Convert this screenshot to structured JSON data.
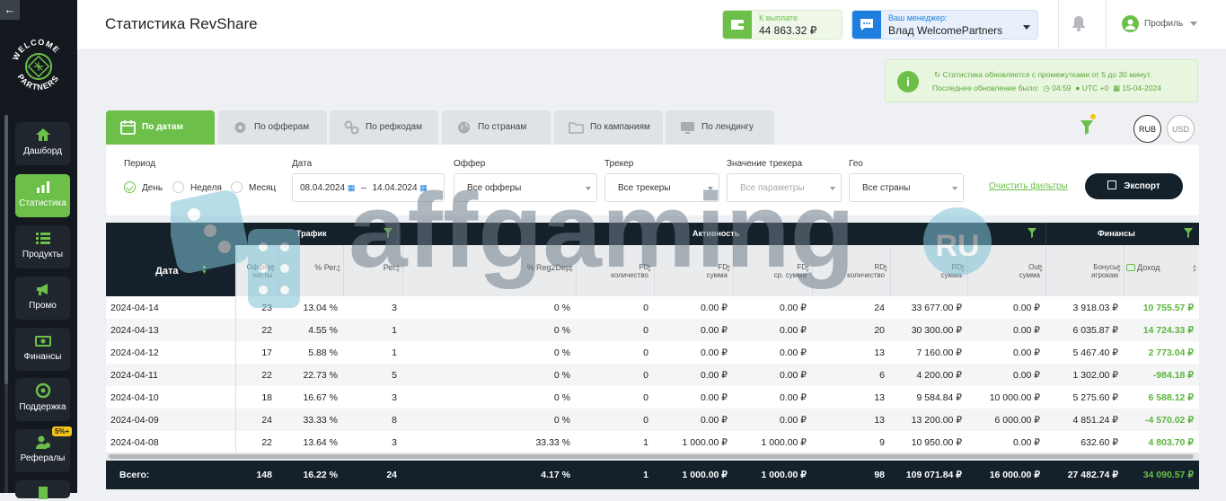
{
  "sidebar": {
    "logo_text": "WELCOME PARTNERS",
    "items": [
      {
        "label": "Дашборд",
        "icon": "home-icon",
        "active": false
      },
      {
        "label": "Статистика",
        "icon": "chart-icon",
        "active": true
      },
      {
        "label": "Продукты",
        "icon": "list-icon",
        "active": false
      },
      {
        "label": "Промо",
        "icon": "megaphone-icon",
        "active": false
      },
      {
        "label": "Финансы",
        "icon": "money-icon",
        "active": false
      },
      {
        "label": "Поддержка",
        "icon": "lifebuoy-icon",
        "active": false
      },
      {
        "label": "Рефералы",
        "icon": "referral-icon",
        "active": false,
        "badge": "5%+"
      }
    ]
  },
  "header": {
    "title": "Статистика RevShare",
    "payout": {
      "label": "К выплате",
      "value": "44 863.32 ₽"
    },
    "manager": {
      "label": "Ваш менеджер:",
      "name": "Влад WelcomePartners"
    },
    "profile_label": "Профиль"
  },
  "notice": {
    "line1": "Статистика обновляется с промежутками от 5 до 30 минут.",
    "prefix": "Последнее обновление было:",
    "time": "04:59",
    "tz": "UTC +0",
    "date": "15-04-2024"
  },
  "tabs": [
    {
      "label": "По датам",
      "icon": "calendar-icon",
      "active": true
    },
    {
      "label": "По офферам",
      "icon": "gear-icon",
      "active": false
    },
    {
      "label": "По рефкодам",
      "icon": "link-icon",
      "active": false
    },
    {
      "label": "По странам",
      "icon": "globe-icon",
      "active": false
    },
    {
      "label": "По кампаниям",
      "icon": "folder-icon",
      "active": false
    },
    {
      "label": "По лендингу",
      "icon": "monitor-icon",
      "active": false
    }
  ],
  "currency": {
    "rub": "RUB",
    "usd": "USD",
    "selected": "RUB"
  },
  "filters": {
    "period_label": "Период",
    "period_options": [
      "День",
      "Неделя",
      "Месяц"
    ],
    "period_selected": "День",
    "date_label": "Дата",
    "date_from": "08.04.2024",
    "date_to": "14.04.2024",
    "offer_label": "Оффер",
    "offer_value": "Все офферы",
    "tracker_label": "Трекер",
    "tracker_value": "Все трекеры",
    "tracker_value_label": "Значение трекера",
    "tracker_value_placeholder": "Все параметры",
    "geo_label": "Гео",
    "geo_value": "Все страны",
    "clear": "Очистить фильтры",
    "export": "Экспорт"
  },
  "table": {
    "groups": {
      "traffic": "Трафик",
      "activity": "Активность",
      "finance": "Финансы"
    },
    "date_header": "Дата",
    "columns": [
      {
        "l1": "Оффер",
        "l2": "хосты"
      },
      {
        "l1": "% Рег.",
        "l2": ""
      },
      {
        "l1": "Рег.",
        "l2": ""
      },
      {
        "l1": "% Reg2Dep",
        "l2": ""
      },
      {
        "l1": "FD",
        "l2": "количество"
      },
      {
        "l1": "FD",
        "l2": "сумма"
      },
      {
        "l1": "FD",
        "l2": "ср. сумма"
      },
      {
        "l1": "RD",
        "l2": "количество"
      },
      {
        "l1": "RD",
        "l2": "сумма"
      },
      {
        "l1": "Out",
        "l2": "сумма"
      },
      {
        "l1": "Бонусы",
        "l2": "игрокам"
      },
      {
        "l1": "Доход",
        "l2": ""
      }
    ],
    "rows": [
      {
        "date": "2024-04-14",
        "vals": [
          "23",
          "13.04 %",
          "3",
          "0 %",
          "0",
          "0.00 ₽",
          "0.00 ₽",
          "24",
          "33 677.00 ₽",
          "0.00 ₽",
          "3 918.03 ₽",
          "10 755.57 ₽"
        ]
      },
      {
        "date": "2024-04-13",
        "vals": [
          "22",
          "4.55 %",
          "1",
          "0 %",
          "0",
          "0.00 ₽",
          "0.00 ₽",
          "20",
          "30 300.00 ₽",
          "0.00 ₽",
          "6 035.87 ₽",
          "14 724.33 ₽"
        ]
      },
      {
        "date": "2024-04-12",
        "vals": [
          "17",
          "5.88 %",
          "1",
          "0 %",
          "0",
          "0.00 ₽",
          "0.00 ₽",
          "13",
          "7 160.00 ₽",
          "0.00 ₽",
          "5 467.40 ₽",
          "2 773.04 ₽"
        ]
      },
      {
        "date": "2024-04-11",
        "vals": [
          "22",
          "22.73 %",
          "5",
          "0 %",
          "0",
          "0.00 ₽",
          "0.00 ₽",
          "6",
          "4 200.00 ₽",
          "0.00 ₽",
          "1 302.00 ₽",
          "-984.18 ₽"
        ]
      },
      {
        "date": "2024-04-10",
        "vals": [
          "18",
          "16.67 %",
          "3",
          "0 %",
          "0",
          "0.00 ₽",
          "0.00 ₽",
          "13",
          "9 584.84 ₽",
          "10 000.00 ₽",
          "5 275.60 ₽",
          "6 588.12 ₽"
        ]
      },
      {
        "date": "2024-04-09",
        "vals": [
          "24",
          "33.33 %",
          "8",
          "0 %",
          "0",
          "0.00 ₽",
          "0.00 ₽",
          "13",
          "13 200.00 ₽",
          "6 000.00 ₽",
          "4 851.24 ₽",
          "-4 570.02 ₽"
        ]
      },
      {
        "date": "2024-04-08",
        "vals": [
          "22",
          "13.64 %",
          "3",
          "33.33 %",
          "1",
          "1 000.00 ₽",
          "1 000.00 ₽",
          "9",
          "10 950.00 ₽",
          "0.00 ₽",
          "632.60 ₽",
          "4 803.70 ₽"
        ]
      }
    ],
    "totals": {
      "label": "Всего:",
      "vals": [
        "148",
        "16.22 %",
        "24",
        "4.17 %",
        "1",
        "1 000.00 ₽",
        "1 000.00 ₽",
        "98",
        "109 071.84 ₽",
        "16 000.00 ₽",
        "27 482.74 ₽",
        "34 090.57 ₽"
      ]
    }
  },
  "watermark": {
    "text": "affgaming",
    "suffix": "RU"
  },
  "colors": {
    "accent": "#6cc04a",
    "dark": "#14212b",
    "income": "#5bb53a",
    "manager": "#1e7fe0"
  }
}
